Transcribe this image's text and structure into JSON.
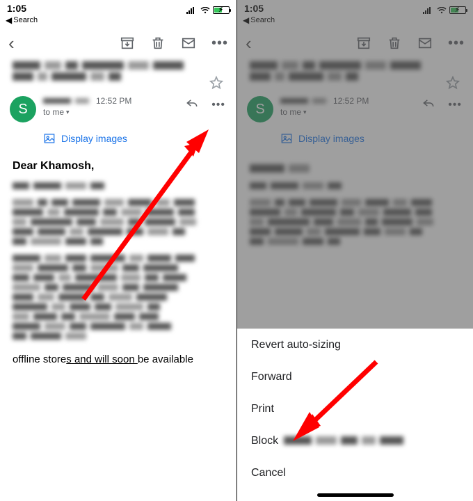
{
  "status": {
    "time": "1:05",
    "back_label": "Search"
  },
  "toolbar": {
    "archive_icon": "archive",
    "delete_icon": "trash",
    "mail_icon": "envelope",
    "more_icon": "more"
  },
  "sender": {
    "avatar_letter": "S",
    "timestamp": "12:52 PM",
    "to_line": "to me"
  },
  "display_images_label": "Display images",
  "greeting": "Dear Khamosh,",
  "footer_fragment_a": "offline store",
  "footer_fragment_u": "s and will soon ",
  "footer_fragment_b": "be available",
  "sheet": {
    "revert": "Revert auto-sizing",
    "forward": "Forward",
    "print": "Print",
    "block": "Block",
    "cancel": "Cancel"
  },
  "colors": {
    "accent": "#1a73e8",
    "avatar": "#1ba260",
    "arrow": "#ff0000",
    "battery": "#34c759"
  }
}
